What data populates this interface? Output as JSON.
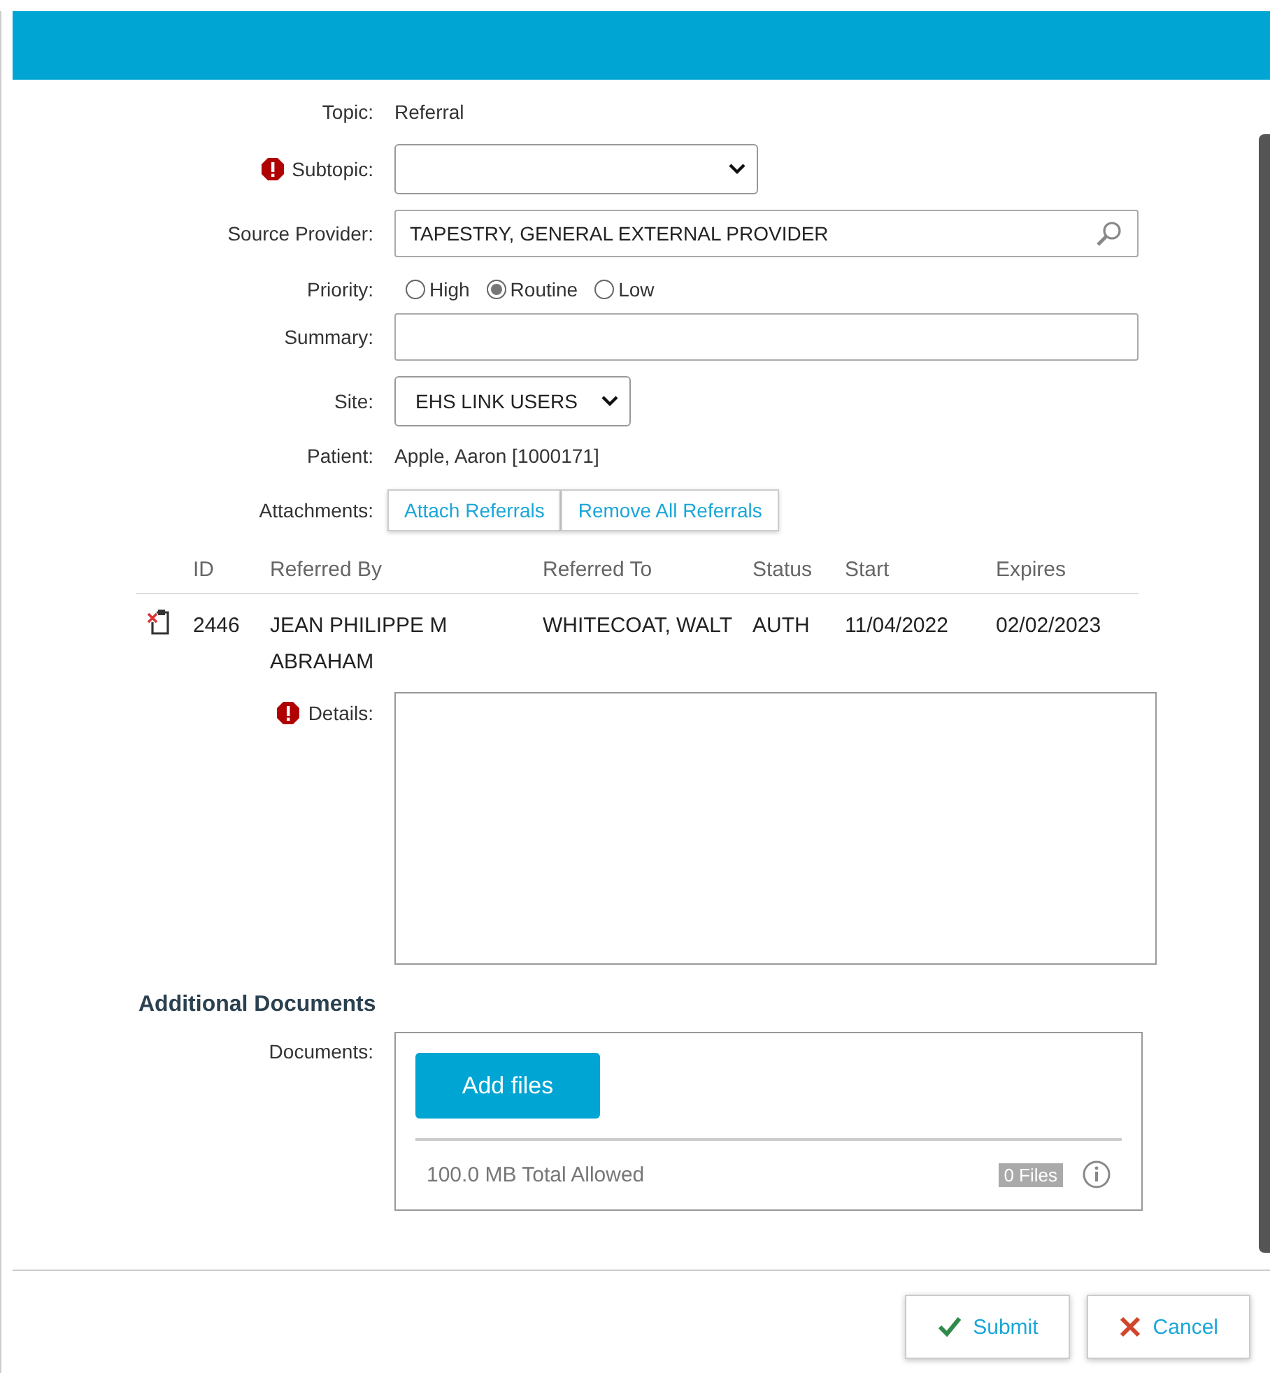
{
  "form": {
    "fields": [
      {
        "kind": "text",
        "label": "Topic:",
        "value": "Referral",
        "required": false
      },
      {
        "kind": "select",
        "label": "Subtopic:",
        "required": true
      },
      {
        "kind": "lookup",
        "label": "Source Provider:",
        "value": "TAPESTRY, GENERAL EXTERNAL PROVIDER",
        "required": false
      },
      {
        "kind": "radio",
        "label": "Priority:",
        "required": false,
        "options": [
          {
            "label": "High",
            "selected": false
          },
          {
            "label": "Routine",
            "selected": true
          },
          {
            "label": "Low",
            "selected": false
          }
        ]
      },
      {
        "kind": "input",
        "label": "Summary:",
        "required": false
      },
      {
        "kind": "select",
        "label": "Site:",
        "value": "EHS LINK USERS",
        "required": false
      },
      {
        "kind": "text",
        "label": "Patient:",
        "value": "Apple, Aaron [1000171]",
        "required": false
      },
      {
        "kind": "buttons",
        "label": "Attachments:",
        "required": false,
        "buttons": [
          "Attach Referrals",
          "Remove All Referrals"
        ]
      }
    ]
  },
  "referrals": {
    "columns": [
      "ID",
      "Referred By",
      "Referred To",
      "Status",
      "Start",
      "Expires"
    ],
    "rows": [
      {
        "id": "2446",
        "referred_by": "JEAN PHILIPPE M ABRAHAM",
        "referred_to": "WHITECOAT, WALT",
        "status": "AUTH",
        "start": "11/04/2022",
        "expires": "02/02/2023"
      }
    ]
  },
  "details": {
    "label": "Details:",
    "required": true
  },
  "additional_documents": {
    "heading": "Additional Documents",
    "label": "Documents:",
    "add_button": "Add files",
    "total": "100.0 MB Total Allowed",
    "count": "0 Files"
  },
  "footer": {
    "buttons": [
      {
        "kind": "submit",
        "label": "Submit"
      },
      {
        "kind": "cancel",
        "label": "Cancel"
      }
    ]
  }
}
